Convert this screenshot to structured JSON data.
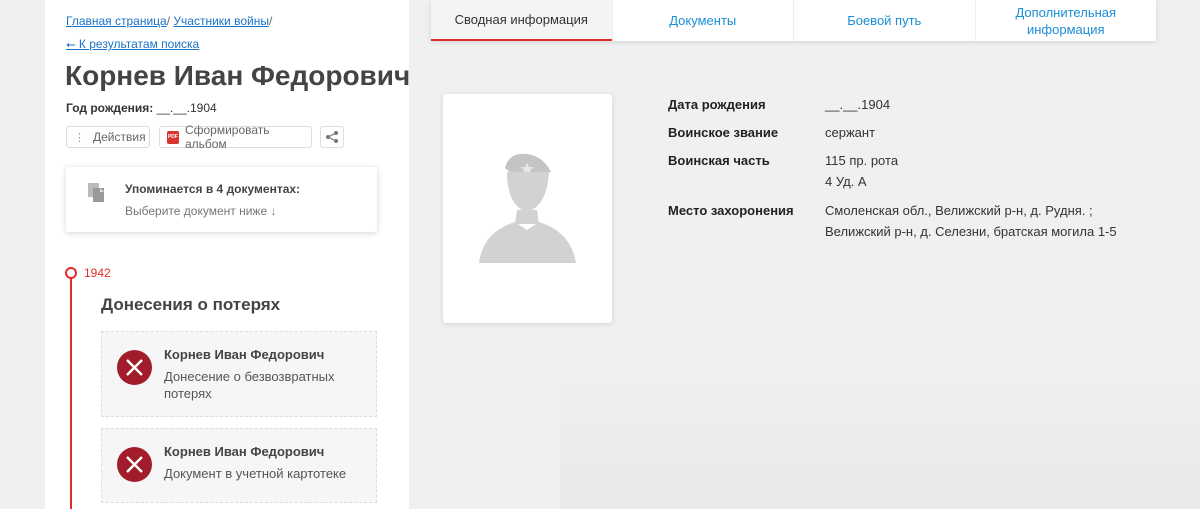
{
  "breadcrumb": {
    "home": "Главная страница",
    "sep1": "/",
    "participants": "Участники войны",
    "sep2": "/",
    "back": "⭠ К результатам поиска"
  },
  "person": {
    "name": "Корнев Иван Федорович",
    "birth_label": "Год рождения:",
    "birth_value": "__.__.1904"
  },
  "actions": {
    "actions_label": "Действия",
    "album_label": "Сформировать альбом",
    "pdf_badge": "PDF"
  },
  "mentions": {
    "title": "Упоминается в 4 документах:",
    "subtitle": "Выберите документ ниже ↓"
  },
  "timeline": {
    "year": "1942",
    "section_title": "Донесения о потерях",
    "documents": [
      {
        "name": "Корнев Иван Федорович",
        "desc": "Донесение о безвозвратных потерях"
      },
      {
        "name": "Корнев Иван Федорович",
        "desc": "Документ в учетной картотеке"
      }
    ]
  },
  "tabs": [
    {
      "label": "Сводная информация",
      "active": true
    },
    {
      "label": "Документы",
      "active": false
    },
    {
      "label": "Боевой путь",
      "active": false
    },
    {
      "label": "Дополнительная информация",
      "active": false
    }
  ],
  "info": {
    "birth_date_label": "Дата рождения",
    "birth_date_value": "__.__.1904",
    "rank_label": "Воинское звание",
    "rank_value": "сержант",
    "unit_label": "Воинская часть",
    "unit_value_1": "115 пр. рота",
    "unit_value_2": "4 Уд. А",
    "burial_label": "Место захоронения",
    "burial_value_1": "Смоленская обл., Велижский р-н, д. Рудня. ;",
    "burial_value_2": "Велижский р-н, д. Селезни, братская могила 1-5"
  },
  "icons": {
    "doc": "documents-icon",
    "share": "share-icon",
    "fail": "x-circle-icon",
    "placeholder": "soldier-silhouette-icon"
  },
  "colors": {
    "accent_red": "#e32b2b",
    "link_blue": "#1a73c8",
    "fail_red": "#a11d2b"
  }
}
